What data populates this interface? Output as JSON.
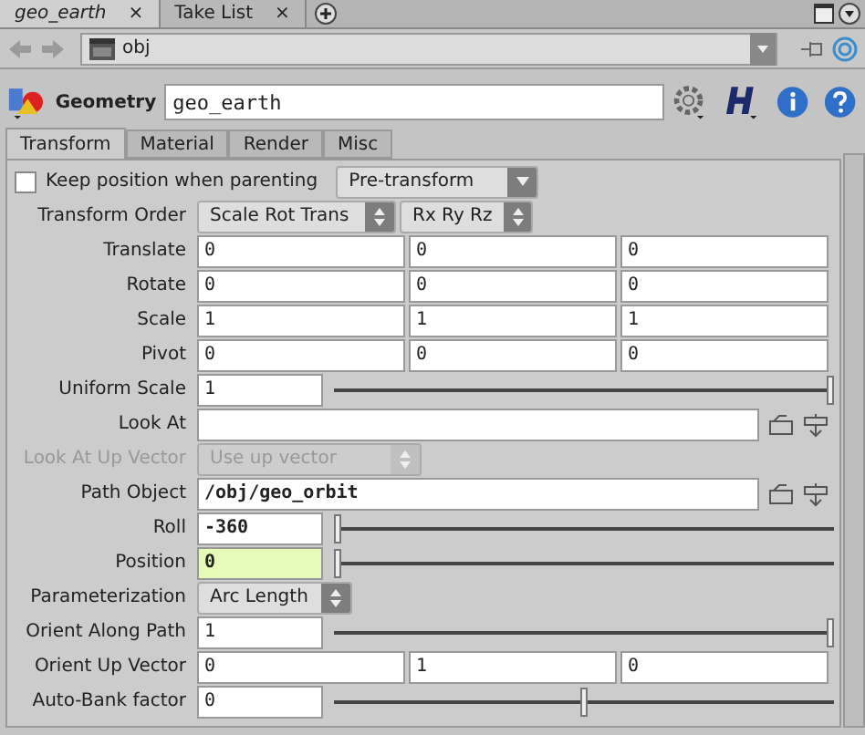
{
  "pane_tabs": [
    {
      "label": "geo_earth",
      "close": "×",
      "selected": true
    },
    {
      "label": "Take List",
      "close": "×",
      "selected": false
    }
  ],
  "path_bar": {
    "value": "obj"
  },
  "node": {
    "type": "Geometry",
    "name": "geo_earth"
  },
  "tabs": [
    {
      "label": "Transform",
      "selected": true
    },
    {
      "label": "Material",
      "selected": false
    },
    {
      "label": "Render",
      "selected": false
    },
    {
      "label": "Misc",
      "selected": false
    }
  ],
  "parameters": [
    {
      "kind": "checkbox_menu",
      "label": "Keep position when parenting",
      "checked": false,
      "menu": "Pre-transform"
    },
    {
      "kind": "menus",
      "label": "Transform Order",
      "menus": [
        "Scale Rot Trans",
        "Rx Ry Rz"
      ]
    },
    {
      "kind": "vector",
      "label": "Translate",
      "values": [
        "0",
        "0",
        "0"
      ]
    },
    {
      "kind": "vector",
      "label": "Rotate",
      "values": [
        "0",
        "0",
        "0"
      ]
    },
    {
      "kind": "vector",
      "label": "Scale",
      "values": [
        "1",
        "1",
        "1"
      ]
    },
    {
      "kind": "vector",
      "label": "Pivot",
      "values": [
        "0",
        "0",
        "0"
      ]
    },
    {
      "kind": "slider",
      "label": "Uniform Scale",
      "value": "1",
      "level": 1,
      "modified": false,
      "keyframed": false
    },
    {
      "kind": "path",
      "label": "Look At"
    },
    {
      "kind": "menu",
      "label": "Look At Up Vector",
      "menu": "Use up vector",
      "disabled": true
    },
    {
      "kind": "path",
      "label": "Path Object",
      "value": "/obj/geo_orbit",
      "modified": true
    },
    {
      "kind": "slider",
      "label": "Roll",
      "value": "-360",
      "level": 0,
      "modified": true,
      "keyframed": false
    },
    {
      "kind": "slider",
      "label": "Position",
      "value": "0",
      "level": 0,
      "modified": true,
      "keyframed": true
    },
    {
      "kind": "menu",
      "label": "Parameterization",
      "menu": "Arc Length",
      "disabled": false
    },
    {
      "kind": "slider",
      "label": "Orient Along Path",
      "value": "1",
      "level": 1,
      "modified": false,
      "keyframed": false
    },
    {
      "kind": "vector",
      "label": "Orient Up Vector",
      "values": [
        "0",
        "1",
        "0"
      ]
    },
    {
      "kind": "slider",
      "label": "Auto-Bank factor",
      "value": "0",
      "level": 0.5,
      "modified": false,
      "keyframed": false
    }
  ]
}
